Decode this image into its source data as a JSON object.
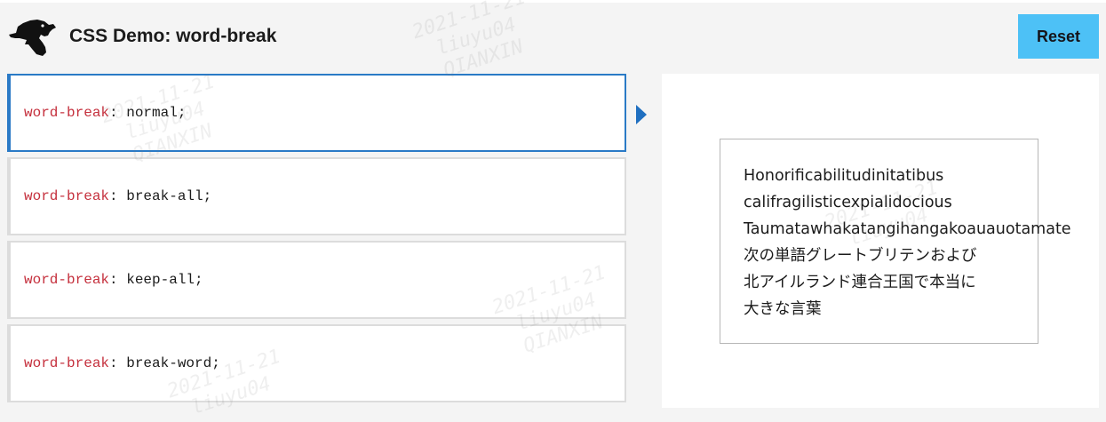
{
  "header": {
    "title": "CSS Demo: word-break",
    "reset_label": "Reset"
  },
  "choices": [
    {
      "property": "word-break",
      "value": "normal;",
      "selected": true
    },
    {
      "property": "word-break",
      "value": "break-all;",
      "selected": false
    },
    {
      "property": "word-break",
      "value": "keep-all;",
      "selected": false
    },
    {
      "property": "word-break",
      "value": "break-word;",
      "selected": false
    }
  ],
  "output": {
    "lines": [
      "Honorificabilitudinitatibus",
      "califragilisticexpialidocious",
      "Taumatawhakatangihangakoauauotamate",
      "次の単語グレートブリテンおよび",
      "北アイルランド連合王国で本当に",
      "大きな言葉"
    ]
  },
  "watermark": {
    "lines": [
      "2021-11-21",
      "liuyu04",
      "QIANXIN"
    ]
  },
  "colors": {
    "accent": "#2a7ac6",
    "reset_bg": "#4dc1f6",
    "property": "#c5303d"
  }
}
